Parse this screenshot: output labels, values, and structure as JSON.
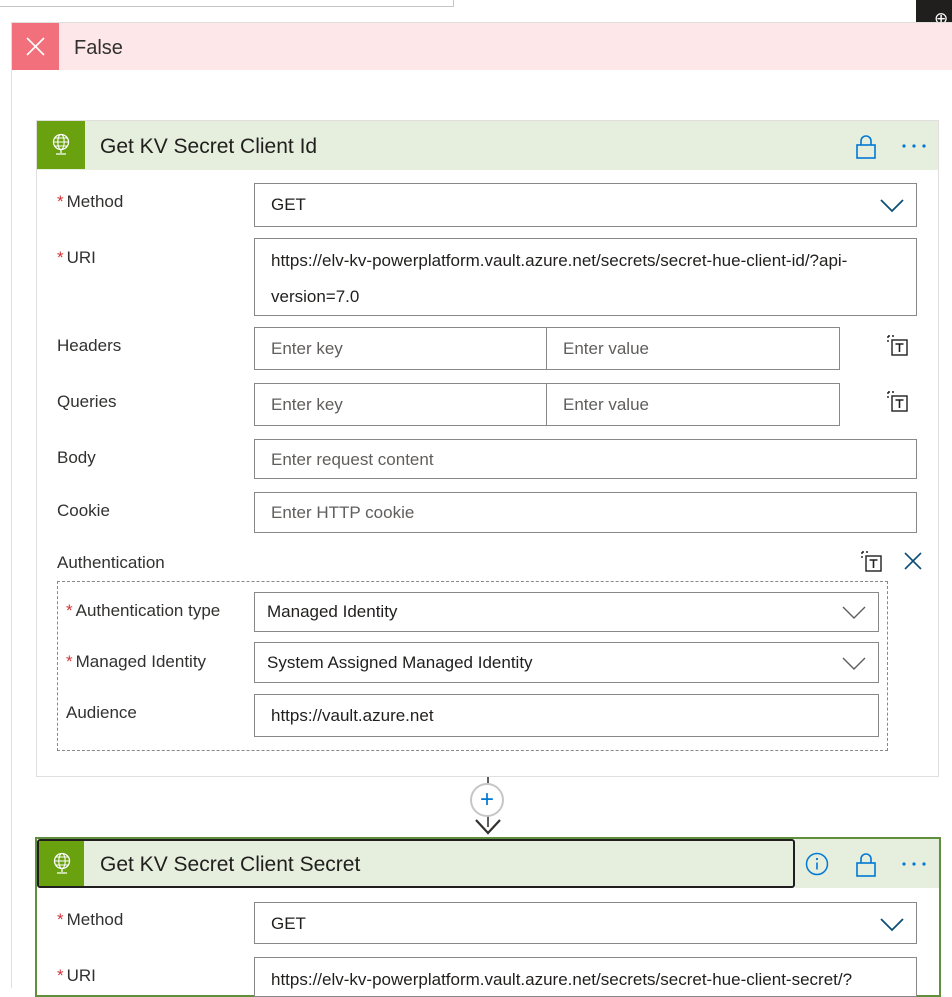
{
  "scope": {
    "label": "False"
  },
  "actions": [
    {
      "title": "Get KV Secret Client Id",
      "method_label": "Method",
      "method_value": "GET",
      "uri_label": "URI",
      "uri_line1": "https://elv-kv-powerplatform.vault.azure.net/secrets/secret-hue-client-id/?api-",
      "uri_line2": "version=7.0",
      "headers_label": "Headers",
      "queries_label": "Queries",
      "key_placeholder": "Enter key",
      "value_placeholder": "Enter value",
      "body_label": "Body",
      "body_placeholder": "Enter request content",
      "cookie_label": "Cookie",
      "cookie_placeholder": "Enter HTTP cookie",
      "auth_label": "Authentication",
      "auth_type_label": "Authentication type",
      "auth_type_value": "Managed Identity",
      "managed_identity_label": "Managed Identity",
      "managed_identity_value": "System Assigned Managed Identity",
      "audience_label": "Audience",
      "audience_value": "https://vault.azure.net"
    },
    {
      "title": "Get KV Secret Client Secret",
      "method_label": "Method",
      "method_value": "GET",
      "uri_label": "URI",
      "uri_line1": "https://elv-kv-powerplatform.vault.azure.net/secrets/secret-hue-client-secret/?"
    }
  ],
  "required_marker": "*",
  "add_step_symbol": "+",
  "icons": {
    "scope_close": "close-icon",
    "action": "globe-icon",
    "lock": "lock-icon",
    "more": "more-icon",
    "info": "info-icon",
    "switch_text": "text-mode-icon",
    "chevron": "chevron-down-icon"
  },
  "colors": {
    "false_bar": "#fde7e9",
    "false_icon": "#f1707b",
    "action_header": "#e6eedd",
    "action_icon": "#69a10f",
    "accent": "#0078d4",
    "required": "#d13438"
  }
}
